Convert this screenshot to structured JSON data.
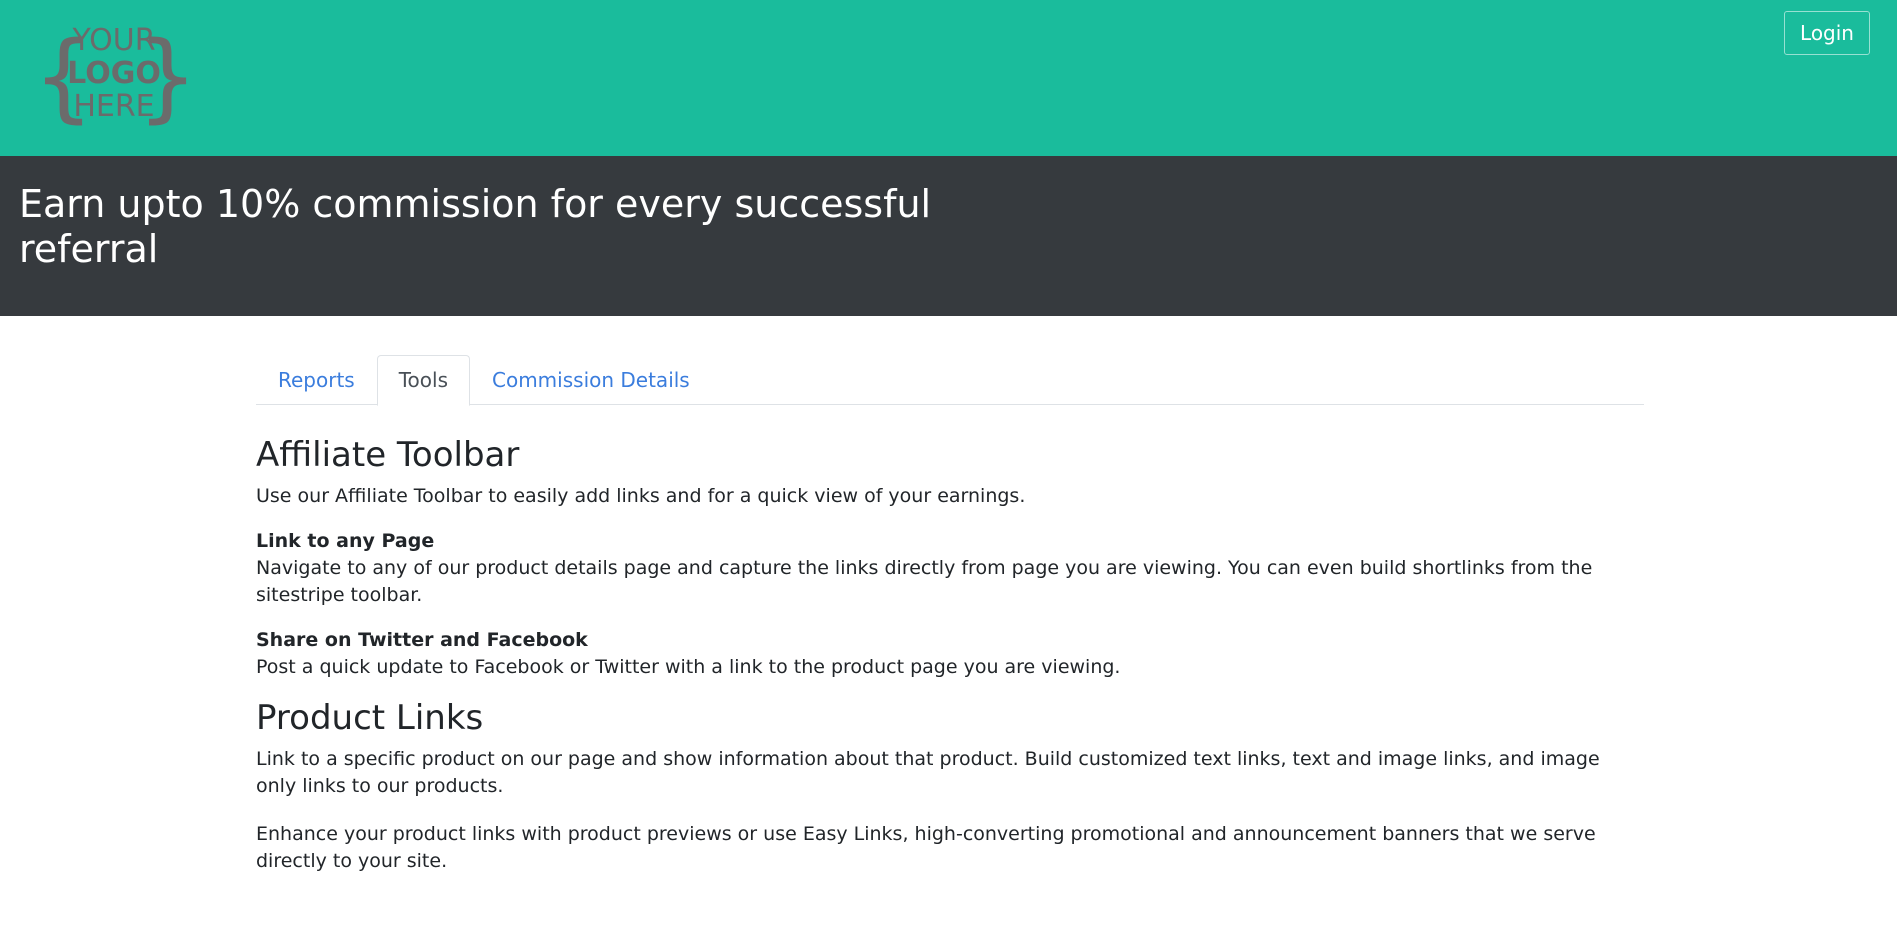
{
  "header": {
    "logo": {
      "line1": "YOUR",
      "line2": "LOGO",
      "line3": "HERE"
    },
    "login_label": "Login",
    "background_color": "#1abc9c"
  },
  "hero": {
    "headline": "Earn upto 10% commission for every successful referral",
    "background_color": "#363a3e"
  },
  "tabs": [
    {
      "label": "Reports",
      "active": false
    },
    {
      "label": "Tools",
      "active": true
    },
    {
      "label": "Commission Details",
      "active": false
    }
  ],
  "sections": {
    "toolbar": {
      "title": "Affiliate Toolbar",
      "intro": "Use our Affiliate Toolbar to easily add links and for a quick view of your earnings.",
      "features": [
        {
          "title": "Link to any Page",
          "text": "Navigate to any of our product details page and capture the links directly from page you are viewing. You can even build shortlinks from the sitestripe toolbar."
        },
        {
          "title": "Share on Twitter and Facebook",
          "text": "Post a quick update to Facebook or Twitter with a link to the product page you are viewing."
        }
      ]
    },
    "product_links": {
      "title": "Product Links",
      "paragraphs": [
        "Link to a specific product on our page and show information about that product. Build customized text links, text and image links, and image only links to our products.",
        "Enhance your product links with product previews or use Easy Links, high-converting promotional and announcement banners that we serve directly to your site."
      ]
    }
  },
  "colors": {
    "accent_link": "#3b7ddd",
    "logo_gray": "#6b6b6b"
  }
}
